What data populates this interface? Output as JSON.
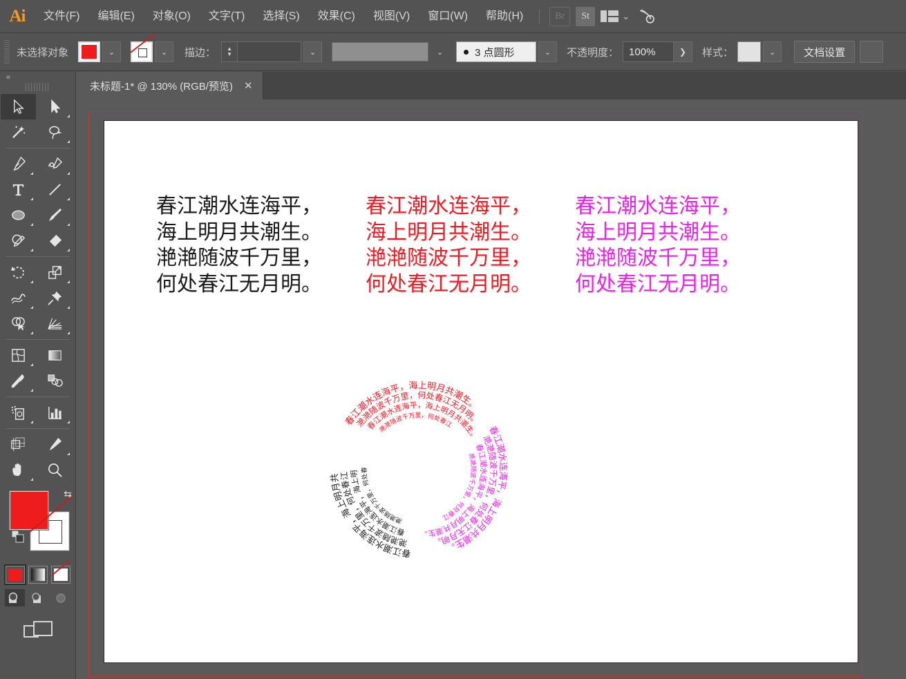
{
  "app": {
    "name": "Adobe Illustrator",
    "logo_text": "Ai"
  },
  "menubar": {
    "items": [
      {
        "label": "文件(F)",
        "name": "menu-file"
      },
      {
        "label": "编辑(E)",
        "name": "menu-edit"
      },
      {
        "label": "对象(O)",
        "name": "menu-object"
      },
      {
        "label": "文字(T)",
        "name": "menu-type"
      },
      {
        "label": "选择(S)",
        "name": "menu-select"
      },
      {
        "label": "效果(C)",
        "name": "menu-effect"
      },
      {
        "label": "视图(V)",
        "name": "menu-view"
      },
      {
        "label": "窗口(W)",
        "name": "menu-window"
      },
      {
        "label": "帮助(H)",
        "name": "menu-help"
      }
    ],
    "bridge_label": "Br",
    "stock_label": "St",
    "workspace_label": "",
    "chevron": "⌄"
  },
  "controlbar": {
    "selection_status": "未选择对象",
    "fill_color": "#EE1C1C",
    "stroke_color": "none",
    "stroke_label": "描边：",
    "stroke_weight_value": "",
    "profile_value": "",
    "brush_label": "3 点圆形",
    "opacity_label": "不透明度：",
    "opacity_value": "100%",
    "opacity_expand": "❯",
    "style_label": "样式：",
    "style_value": "",
    "document_setup_button": "文档设置"
  },
  "tabbar": {
    "tabs": [
      {
        "title": "未标题-1* @ 130% (RGB/预览)",
        "close": "✕",
        "active": true
      }
    ]
  },
  "toolpanel": {
    "collapse_icon": "«",
    "tools": [
      {
        "name": "selection-tool",
        "label": "选择工具",
        "selected": true
      },
      {
        "name": "direct-selection-tool",
        "label": "直接选择工具",
        "selected": false
      },
      {
        "name": "magic-wand-tool",
        "label": "魔棒工具",
        "selected": false
      },
      {
        "name": "lasso-tool",
        "label": "套索工具",
        "selected": false
      },
      {
        "name": "pen-tool",
        "label": "钢笔工具",
        "selected": false
      },
      {
        "name": "curvature-tool",
        "label": "曲率工具",
        "selected": false
      },
      {
        "name": "type-tool",
        "label": "文字工具",
        "selected": false
      },
      {
        "name": "line-segment-tool",
        "label": "直线段工具",
        "selected": false
      },
      {
        "name": "ellipse-tool",
        "label": "椭圆工具",
        "selected": false
      },
      {
        "name": "paintbrush-tool",
        "label": "画笔工具",
        "selected": false
      },
      {
        "name": "shaper-tool",
        "label": "Shaper 工具",
        "selected": false
      },
      {
        "name": "eraser-tool",
        "label": "橡皮擦工具",
        "selected": false
      },
      {
        "name": "rotate-tool",
        "label": "旋转工具",
        "selected": false
      },
      {
        "name": "scale-tool",
        "label": "比例缩放工具",
        "selected": false
      },
      {
        "name": "width-tool",
        "label": "宽度工具",
        "selected": false
      },
      {
        "name": "free-transform-tool",
        "label": "自由变换工具",
        "selected": false
      },
      {
        "name": "shape-builder-tool",
        "label": "形状生成器工具",
        "selected": false
      },
      {
        "name": "perspective-grid-tool",
        "label": "透视网格工具",
        "selected": false
      },
      {
        "name": "mesh-tool",
        "label": "网格工具",
        "selected": false
      },
      {
        "name": "gradient-tool",
        "label": "渐变工具",
        "selected": false
      },
      {
        "name": "eyedropper-tool",
        "label": "吸管工具",
        "selected": false
      },
      {
        "name": "blend-tool",
        "label": "混合工具",
        "selected": false
      },
      {
        "name": "symbol-sprayer-tool",
        "label": "符号喷枪工具",
        "selected": false
      },
      {
        "name": "column-graph-tool",
        "label": "柱形图工具",
        "selected": false
      },
      {
        "name": "artboard-tool",
        "label": "画板工具",
        "selected": false
      },
      {
        "name": "slice-tool",
        "label": "切片工具",
        "selected": false
      },
      {
        "name": "hand-tool",
        "label": "抓手工具",
        "selected": false
      },
      {
        "name": "zoom-tool",
        "label": "缩放工具",
        "selected": false
      }
    ],
    "fill_color": "#EE1C1C",
    "stroke_color": "#FFFFFF",
    "swap_icon": "⇆",
    "modes": [
      {
        "name": "color-mode-button",
        "label": "颜色",
        "active": true
      },
      {
        "name": "gradient-mode-button",
        "label": "渐变",
        "active": false
      },
      {
        "name": "none-mode-button",
        "label": "无",
        "active": false
      }
    ],
    "draw_modes": [
      {
        "name": "draw-normal-button",
        "label": "正常绘图",
        "active": true
      },
      {
        "name": "draw-behind-button",
        "label": "背面绘图",
        "active": false
      },
      {
        "name": "draw-inside-button",
        "label": "内部绘图",
        "active": false
      }
    ],
    "screen_mode": {
      "name": "screen-mode-button",
      "label": "更改屏幕模式"
    }
  },
  "canvas": {
    "zoom": "130%",
    "color_mode": "RGB",
    "preview_mode": "预览",
    "poem_lines": [
      "春江潮水连海平，",
      "海上明月共潮生。",
      "滟滟随波千万里，",
      "何处春江无月明。"
    ],
    "poem_text": "春江潮水连海平，\n海上明月共潮生。\n滟滟随波千万里，\n何处春江无月明。",
    "text_blocks": [
      {
        "name": "poem-black",
        "color": "#1A1A1A"
      },
      {
        "name": "poem-red",
        "color": "#ED1C24"
      },
      {
        "name": "poem-magenta",
        "color": "#E524E5"
      }
    ],
    "artwork": {
      "name": "circular-warped-text-artwork",
      "description": "三段环形变形文字",
      "arcs": [
        {
          "name": "arc-magenta",
          "color": "#E524E5",
          "start_deg": 150,
          "end_deg": 265
        },
        {
          "name": "arc-black",
          "color": "#222222",
          "start_deg": 272,
          "end_deg": 20
        },
        {
          "name": "arc-red",
          "color": "#ED1C24",
          "start_deg": 35,
          "end_deg": 145
        }
      ]
    }
  }
}
